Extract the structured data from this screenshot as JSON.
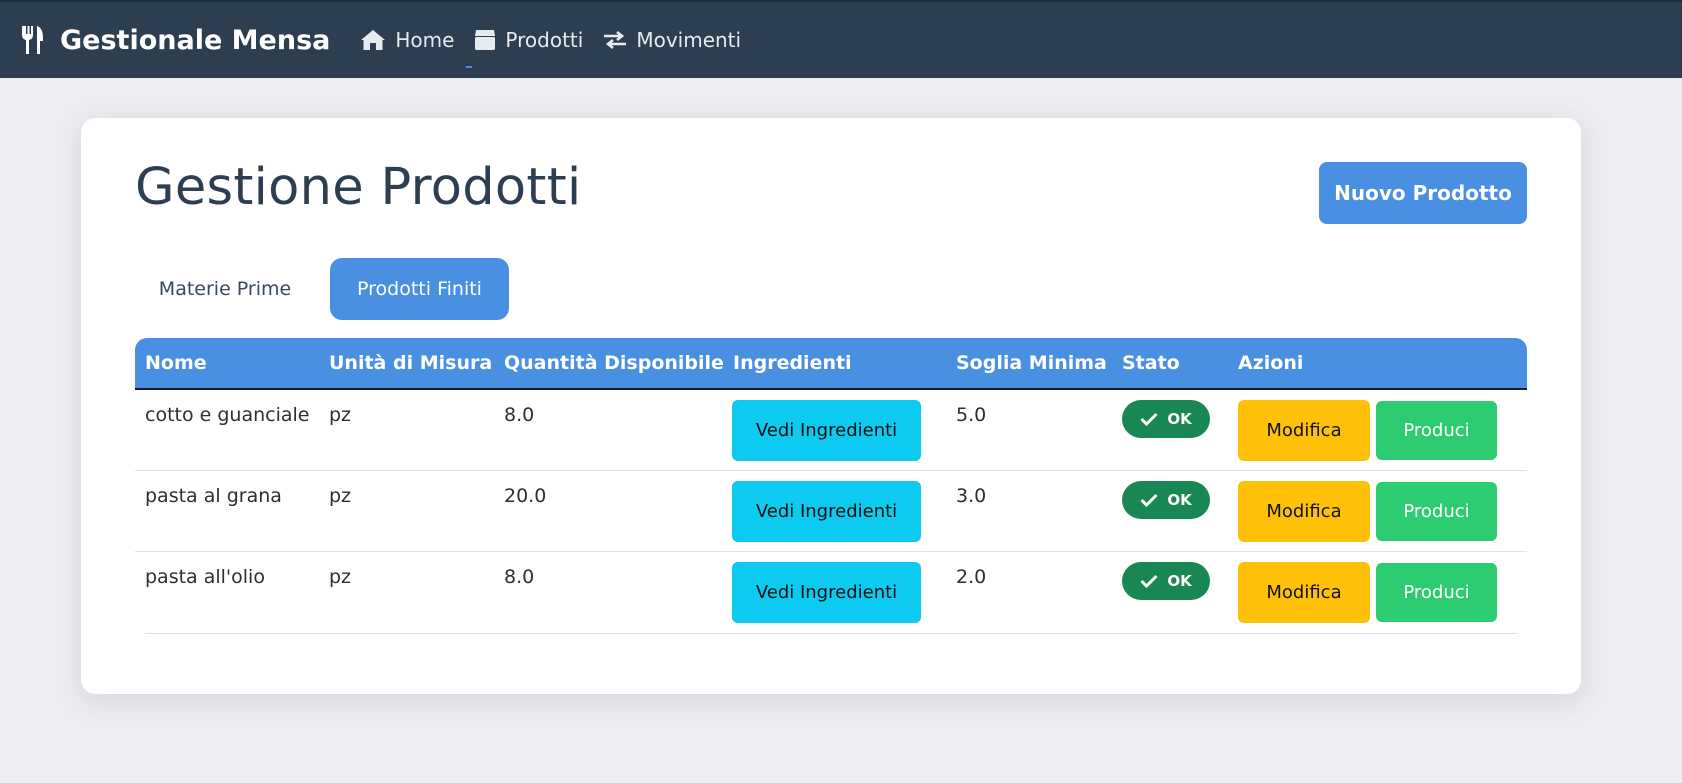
{
  "navbar": {
    "brand": "Gestionale Mensa",
    "brand_icon": "utensils-icon",
    "links": [
      {
        "label": "Home",
        "icon": "home-icon"
      },
      {
        "label": "Prodotti",
        "icon": "box-icon"
      },
      {
        "label": "Movimenti",
        "icon": "exchange-icon"
      }
    ]
  },
  "page": {
    "title": "Gestione Prodotti",
    "new_button": "Nuovo Prodotto",
    "tabs": [
      {
        "label": "Materie Prime",
        "active": false
      },
      {
        "label": "Prodotti Finiti",
        "active": true
      }
    ]
  },
  "table": {
    "headers": [
      "Nome",
      "Unità di Misura",
      "Quantità Disponibile",
      "Ingredienti",
      "Soglia Minima",
      "Stato",
      "Azioni"
    ],
    "rows": [
      {
        "nome": "cotto e guanciale",
        "unita": "pz",
        "quantita": "8.0",
        "ingredienti_btn": "Vedi Ingredienti",
        "soglia": "5.0",
        "stato": "OK",
        "modifica": "Modifica",
        "produci": "Produci"
      },
      {
        "nome": "pasta al grana",
        "unita": "pz",
        "quantita": "20.0",
        "ingredienti_btn": "Vedi Ingredienti",
        "soglia": "3.0",
        "stato": "OK",
        "modifica": "Modifica",
        "produci": "Produci"
      },
      {
        "nome": "pasta all'olio",
        "unita": "pz",
        "quantita": "8.0",
        "ingredienti_btn": "Vedi Ingredienti",
        "soglia": "2.0",
        "stato": "OK",
        "modifica": "Modifica",
        "produci": "Produci"
      }
    ]
  },
  "colors": {
    "navbar": "#2c3e50",
    "primary": "#4a90e2",
    "info": "#0dcaf0",
    "warning": "#ffc107",
    "success": "#2ecc71",
    "badge_ok": "#198754"
  }
}
